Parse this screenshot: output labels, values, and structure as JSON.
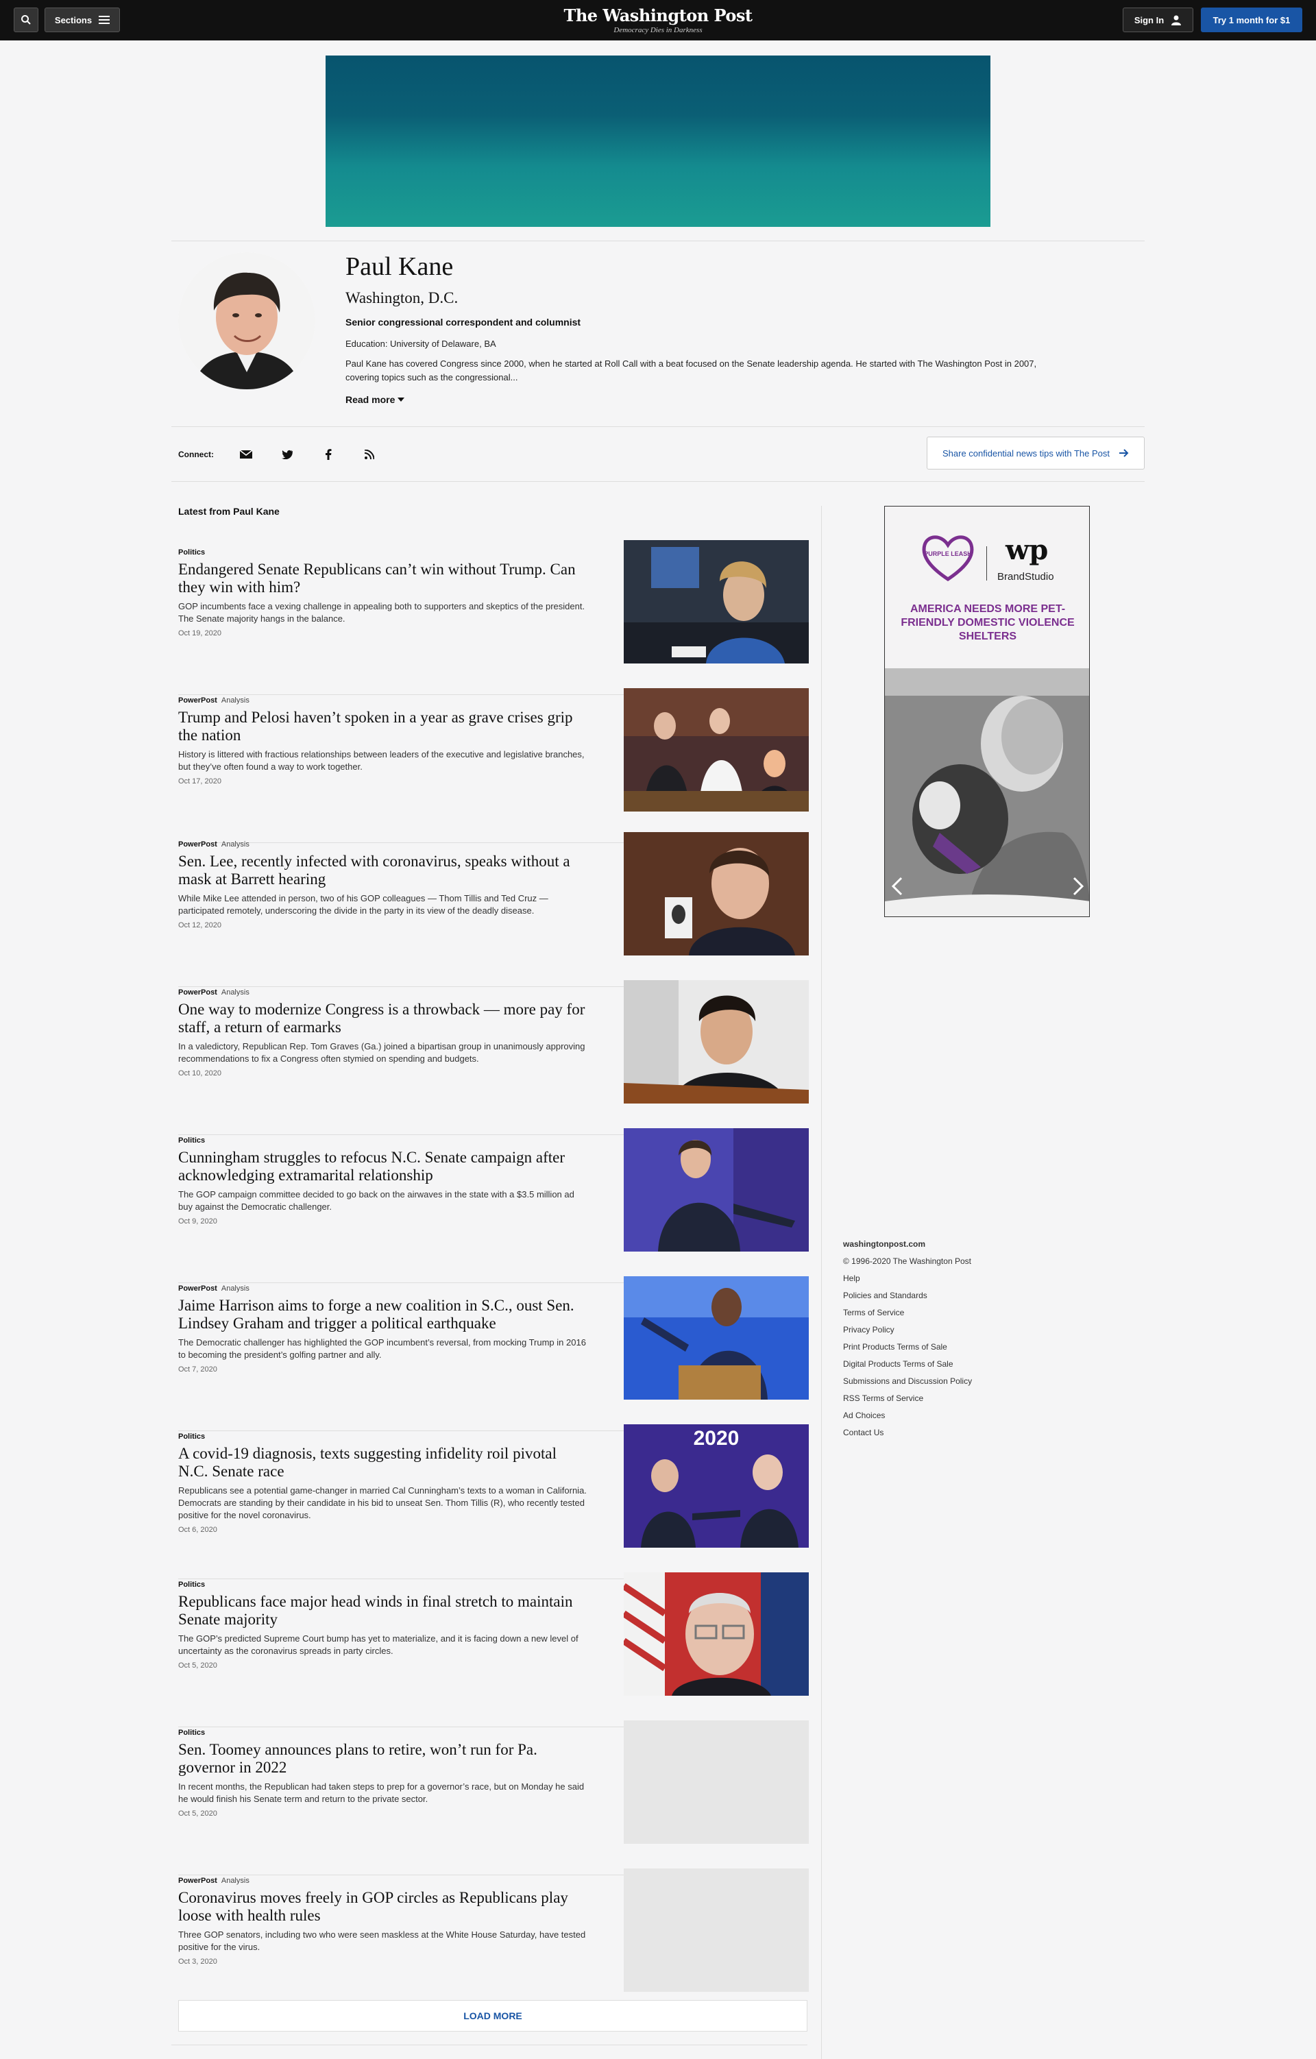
{
  "header": {
    "sections_label": "Sections",
    "logo": "The Washington Post",
    "tagline": "Democracy Dies in Darkness",
    "signin_label": "Sign In",
    "try_label": "Try 1 month for $1"
  },
  "author": {
    "name": "Paul Kane",
    "location": "Washington, D.C.",
    "title": "Senior congressional correspondent and columnist",
    "education": "Education: University of Delaware, BA",
    "bio": "Paul Kane has covered Congress since 2000, when he started at Roll Call with a beat focused on the Senate leadership agenda. He started with The Washington Post in 2007, covering topics such as the congressional...",
    "read_more": "Read more"
  },
  "connect": {
    "label": "Connect:",
    "icons": [
      "email-icon",
      "twitter-icon",
      "facebook-icon",
      "rss-icon"
    ],
    "tips_label": "Share confidential news tips with The Post"
  },
  "feed": {
    "heading": "Latest from Paul Kane",
    "stories": [
      {
        "section": "Politics",
        "label": "",
        "headline": "Endangered Senate Republicans can’t win without Trump. Can they win with him?",
        "blurb": "GOP incumbents face a vexing challenge in appealing both to supporters and skeptics of the president. The Senate majority hangs in the balance.",
        "date": "Oct 19, 2020"
      },
      {
        "section": "PowerPost",
        "label": "Analysis",
        "headline": "Trump and Pelosi haven’t spoken in a year as grave crises grip the nation",
        "blurb": "History is littered with fractious relationships between leaders of the executive and legislative branches, but they’ve often found a way to work together.",
        "date": "Oct 17, 2020"
      },
      {
        "section": "PowerPost",
        "label": "Analysis",
        "headline": "Sen. Lee, recently infected with coronavirus, speaks without a mask at Barrett hearing",
        "blurb": "While Mike Lee attended in person, two of his GOP colleagues — Thom Tillis and Ted Cruz — participated remotely, underscoring the divide in the party in its view of the deadly disease.",
        "date": "Oct 12, 2020"
      },
      {
        "section": "PowerPost",
        "label": "Analysis",
        "headline": "One way to modernize Congress is a throwback — more pay for staff, a return of earmarks",
        "blurb": "In a valedictory, Republican Rep. Tom Graves (Ga.) joined a bipartisan group in unanimously approving recommendations to fix a Congress often stymied on spending and budgets.",
        "date": "Oct 10, 2020"
      },
      {
        "section": "Politics",
        "label": "",
        "headline": "Cunningham struggles to refocus N.C. Senate campaign after acknowledging extramarital relationship",
        "blurb": "The GOP campaign committee decided to go back on the airwaves in the state with a $3.5 million ad buy against the Democratic challenger.",
        "date": "Oct 9, 2020"
      },
      {
        "section": "PowerPost",
        "label": "Analysis",
        "headline": "Jaime Harrison aims to forge a new coalition in S.C., oust Sen. Lindsey Graham and trigger a political earthquake",
        "blurb": "The Democratic challenger has highlighted the GOP incumbent’s reversal, from mocking Trump in 2016 to becoming the president’s golfing partner and ally.",
        "date": "Oct 7, 2020"
      },
      {
        "section": "Politics",
        "label": "",
        "headline": "A covid-19 diagnosis, texts suggesting infidelity roil pivotal N.C. Senate race",
        "blurb": "Republicans see a potential game-changer in married Cal Cunningham’s texts to a woman in California. Democrats are standing by their candidate in his bid to unseat Sen. Thom Tillis (R), who recently tested positive for the novel coronavirus.",
        "date": "Oct 6, 2020"
      },
      {
        "section": "Politics",
        "label": "",
        "headline": "Republicans face major head winds in final stretch to maintain Senate majority",
        "blurb": "The GOP’s predicted Supreme Court bump has yet to materialize, and it is facing down a new level of uncertainty as the coronavirus spreads in party circles.",
        "date": "Oct 5, 2020"
      },
      {
        "section": "Politics",
        "label": "",
        "headline": "Sen. Toomey announces plans to retire, won’t run for Pa. governor in 2022",
        "blurb": "In recent months, the Republican had taken steps to prep for a governor’s race, but on Monday he said he would finish his Senate term and return to the private sector.",
        "date": "Oct 5, 2020"
      },
      {
        "section": "PowerPost",
        "label": "Analysis",
        "headline": "Coronavirus moves freely in GOP circles as Republicans play loose with health rules",
        "blurb": "Three GOP senators, including two who were seen maskless at the White House Saturday, have tested positive for the virus.",
        "date": "Oct 3, 2020"
      }
    ],
    "load_more": "LOAD MORE"
  },
  "sidebar_ad": {
    "logo_text": "PURPLE LEASH",
    "brand": "BrandStudio",
    "wp_mono": "wp",
    "message": "AMERICA NEEDS MORE PET-FRIENDLY DOMESTIC VIOLENCE SHELTERS",
    "accent": "#7b2f8f"
  },
  "footer": {
    "site": "washingtonpost.com",
    "copyright": "© 1996-2020 The Washington Post",
    "links": [
      "Help",
      "Policies and Standards",
      "Terms of Service",
      "Privacy Policy",
      "Print Products Terms of Sale",
      "Digital Products Terms of Sale",
      "Submissions and Discussion Policy",
      "RSS Terms of Service",
      "Ad Choices",
      "Contact Us"
    ]
  }
}
